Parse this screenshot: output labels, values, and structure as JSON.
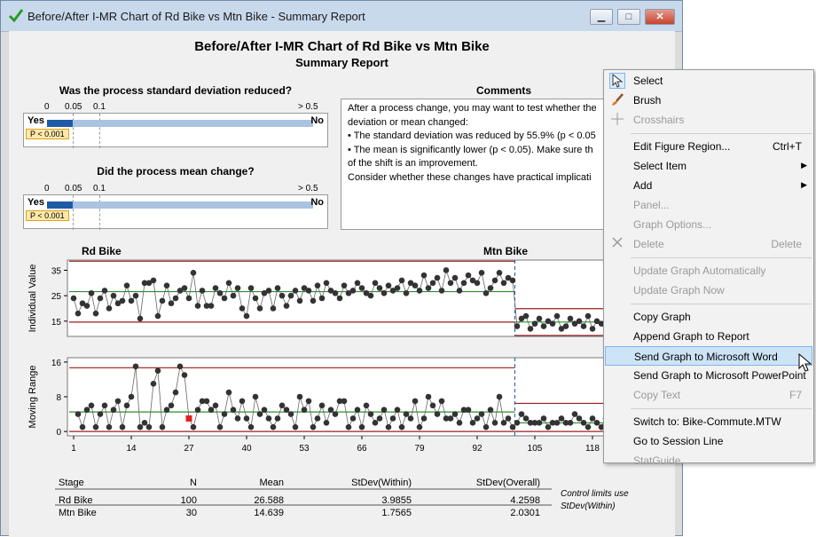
{
  "window": {
    "title": "Before/After I-MR Chart of Rd Bike vs Mtn Bike - Summary Report",
    "min_label": "▁",
    "max_label": "□",
    "close_label": "✕"
  },
  "report": {
    "title": "Before/After I-MR Chart of Rd Bike vs Mtn Bike",
    "subtitle": "Summary Report",
    "q1": "Was the process standard deviation reduced?",
    "q2": "Did the process mean change?",
    "ticks": [
      "0",
      "0.05",
      "0.1",
      "> 0.5"
    ],
    "yes": "Yes",
    "no": "No",
    "pvalue": "P < 0.001",
    "comments_title": "Comments",
    "comments_lines": [
      "After a process change, you may want to test whether the",
      "deviation or mean changed:",
      "•  The standard deviation was reduced by 55.9% (p < 0.05",
      "•  The mean is significantly lower (p < 0.05). Make sure th",
      "of the shift is an improvement.",
      "Consider whether these changes have practical implicati"
    ],
    "stage1": "Rd Bike",
    "stage2": "Mtn Bike",
    "note_lines": [
      "Control limits use",
      "StDev(Within)"
    ]
  },
  "chart_data": [
    {
      "type": "line",
      "ylabel": "Individual Value",
      "yticks": [
        15,
        25,
        35
      ],
      "ylim": [
        9,
        39
      ],
      "stages": [
        "Rd Bike",
        "Mtn Bike"
      ],
      "stage_change_at": 100,
      "values": [
        24,
        18,
        22,
        21,
        26,
        18,
        24,
        27,
        20,
        25,
        22,
        23,
        29,
        23,
        25,
        16,
        30,
        30,
        31,
        17,
        23,
        29,
        22,
        24,
        27,
        28,
        24,
        34,
        21,
        27,
        21,
        21,
        28,
        26,
        24,
        30,
        25,
        28,
        20,
        17,
        28,
        24,
        20,
        26,
        27,
        20,
        28,
        25,
        21,
        25,
        27,
        23,
        28,
        27,
        23,
        29,
        24,
        30,
        27,
        26,
        24,
        29,
        26,
        27,
        30,
        28,
        26,
        25,
        30,
        28,
        26,
        29,
        27,
        28,
        31,
        26,
        30,
        29,
        27,
        33,
        28,
        30,
        32,
        27,
        35,
        30,
        32,
        27,
        30,
        33,
        31,
        30,
        34,
        26,
        28,
        31,
        34,
        30,
        32,
        31,
        13,
        16,
        17,
        12,
        14,
        16,
        13,
        15,
        14,
        17,
        12,
        13,
        16,
        14,
        15,
        13,
        17,
        12,
        15,
        14,
        13,
        11,
        15,
        16,
        14,
        15,
        13,
        16,
        14,
        18
      ],
      "centerlines": [
        {
          "stage": "Rd Bike",
          "mean": 26.588,
          "ucl": 38.545,
          "lcl": 14.632
        },
        {
          "stage": "Mtn Bike",
          "mean": 14.639,
          "ucl": 19.909,
          "lcl": 9.37
        }
      ]
    },
    {
      "type": "line",
      "ylabel": "Moving Range",
      "yticks": [
        0,
        8,
        16
      ],
      "ylim": [
        -1,
        17
      ],
      "xticks": [
        1,
        14,
        27,
        40,
        53,
        66,
        79,
        92,
        105,
        118
      ],
      "values": [
        6,
        4,
        1,
        5,
        6,
        1,
        4,
        6,
        1,
        5,
        7,
        1,
        6,
        8,
        15,
        1,
        2,
        1,
        11,
        14,
        1,
        5,
        6,
        9,
        15,
        13,
        3,
        1,
        5,
        7,
        7,
        5,
        6,
        1,
        4,
        9,
        5,
        3,
        7,
        3,
        1,
        8,
        4,
        5,
        3,
        1,
        3,
        6,
        5,
        4,
        1,
        8,
        5,
        7,
        1,
        3,
        6,
        2,
        5,
        4,
        7,
        7,
        1,
        3,
        5,
        1,
        6,
        4,
        2,
        3,
        5,
        1,
        3,
        5,
        1,
        4,
        3,
        7,
        1,
        3,
        8,
        6,
        4,
        7,
        3,
        3,
        4,
        2,
        5,
        5,
        2,
        3,
        4,
        1,
        5,
        2,
        8,
        2,
        3,
        1,
        2,
        4,
        3,
        2,
        2,
        2,
        3,
        1,
        2,
        2,
        3,
        2,
        2,
        4,
        3,
        2,
        1,
        3,
        2,
        1,
        3,
        1,
        2,
        1,
        1,
        4,
        1,
        2,
        1,
        2
      ],
      "out_of_control_index": 26,
      "centerlines": [
        {
          "stage": "Rd Bike",
          "mean": 4.49,
          "ucl": 14.69,
          "lcl": 0
        },
        {
          "stage": "Mtn Bike",
          "mean": 1.98,
          "ucl": 6.48,
          "lcl": 0
        }
      ]
    },
    {
      "type": "table",
      "headers": [
        "Stage",
        "N",
        "Mean",
        "StDev(Within)",
        "StDev(Overall)"
      ],
      "rows": [
        [
          "Rd Bike",
          "100",
          "26.588",
          "3.9855",
          "4.2598"
        ],
        [
          "Mtn Bike",
          "30",
          "14.639",
          "1.7565",
          "2.0301"
        ]
      ]
    }
  ],
  "menu": {
    "items": [
      {
        "label": "Select",
        "shortcut": "",
        "disabled": false,
        "icon": "cursor-icon"
      },
      {
        "label": "Brush",
        "shortcut": "",
        "disabled": false,
        "icon": "brush-icon"
      },
      {
        "label": "Crosshairs",
        "shortcut": "",
        "disabled": true,
        "icon": "crosshairs-icon"
      },
      {
        "label": "Edit Figure Region...",
        "shortcut": "Ctrl+T",
        "disabled": false
      },
      {
        "label": "Select Item",
        "shortcut": "",
        "disabled": false,
        "submenu": true
      },
      {
        "label": "Add",
        "shortcut": "",
        "disabled": false,
        "submenu": true
      },
      {
        "label": "Panel...",
        "shortcut": "",
        "disabled": true
      },
      {
        "label": "Graph Options...",
        "shortcut": "",
        "disabled": true
      },
      {
        "label": "Delete",
        "shortcut": "Delete",
        "disabled": true,
        "icon": "delete-icon"
      },
      {
        "label": "Update Graph Automatically",
        "shortcut": "",
        "disabled": true
      },
      {
        "label": "Update Graph Now",
        "shortcut": "",
        "disabled": true
      },
      {
        "label": "Copy Graph",
        "shortcut": "",
        "disabled": false
      },
      {
        "label": "Append Graph to Report",
        "shortcut": "",
        "disabled": false
      },
      {
        "label": "Send Graph to Microsoft Word",
        "shortcut": "",
        "disabled": false,
        "highlighted": true
      },
      {
        "label": "Send Graph to Microsoft PowerPoint",
        "shortcut": "",
        "disabled": false
      },
      {
        "label": "Copy Text",
        "shortcut": "F7",
        "disabled": true
      },
      {
        "label": "Switch to: Bike-Commute.MTW",
        "shortcut": "",
        "disabled": false
      },
      {
        "label": "Go to Session Line",
        "shortcut": "",
        "disabled": false
      },
      {
        "label": "StatGuide",
        "shortcut": "",
        "disabled": true
      }
    ]
  },
  "colors": {
    "data": "#333333",
    "center": "#2e8b2e",
    "limit": "#9b1b1b",
    "ooc": "#e02020",
    "fill": "#1f5aa6",
    "bar": "#a9c3e0"
  }
}
